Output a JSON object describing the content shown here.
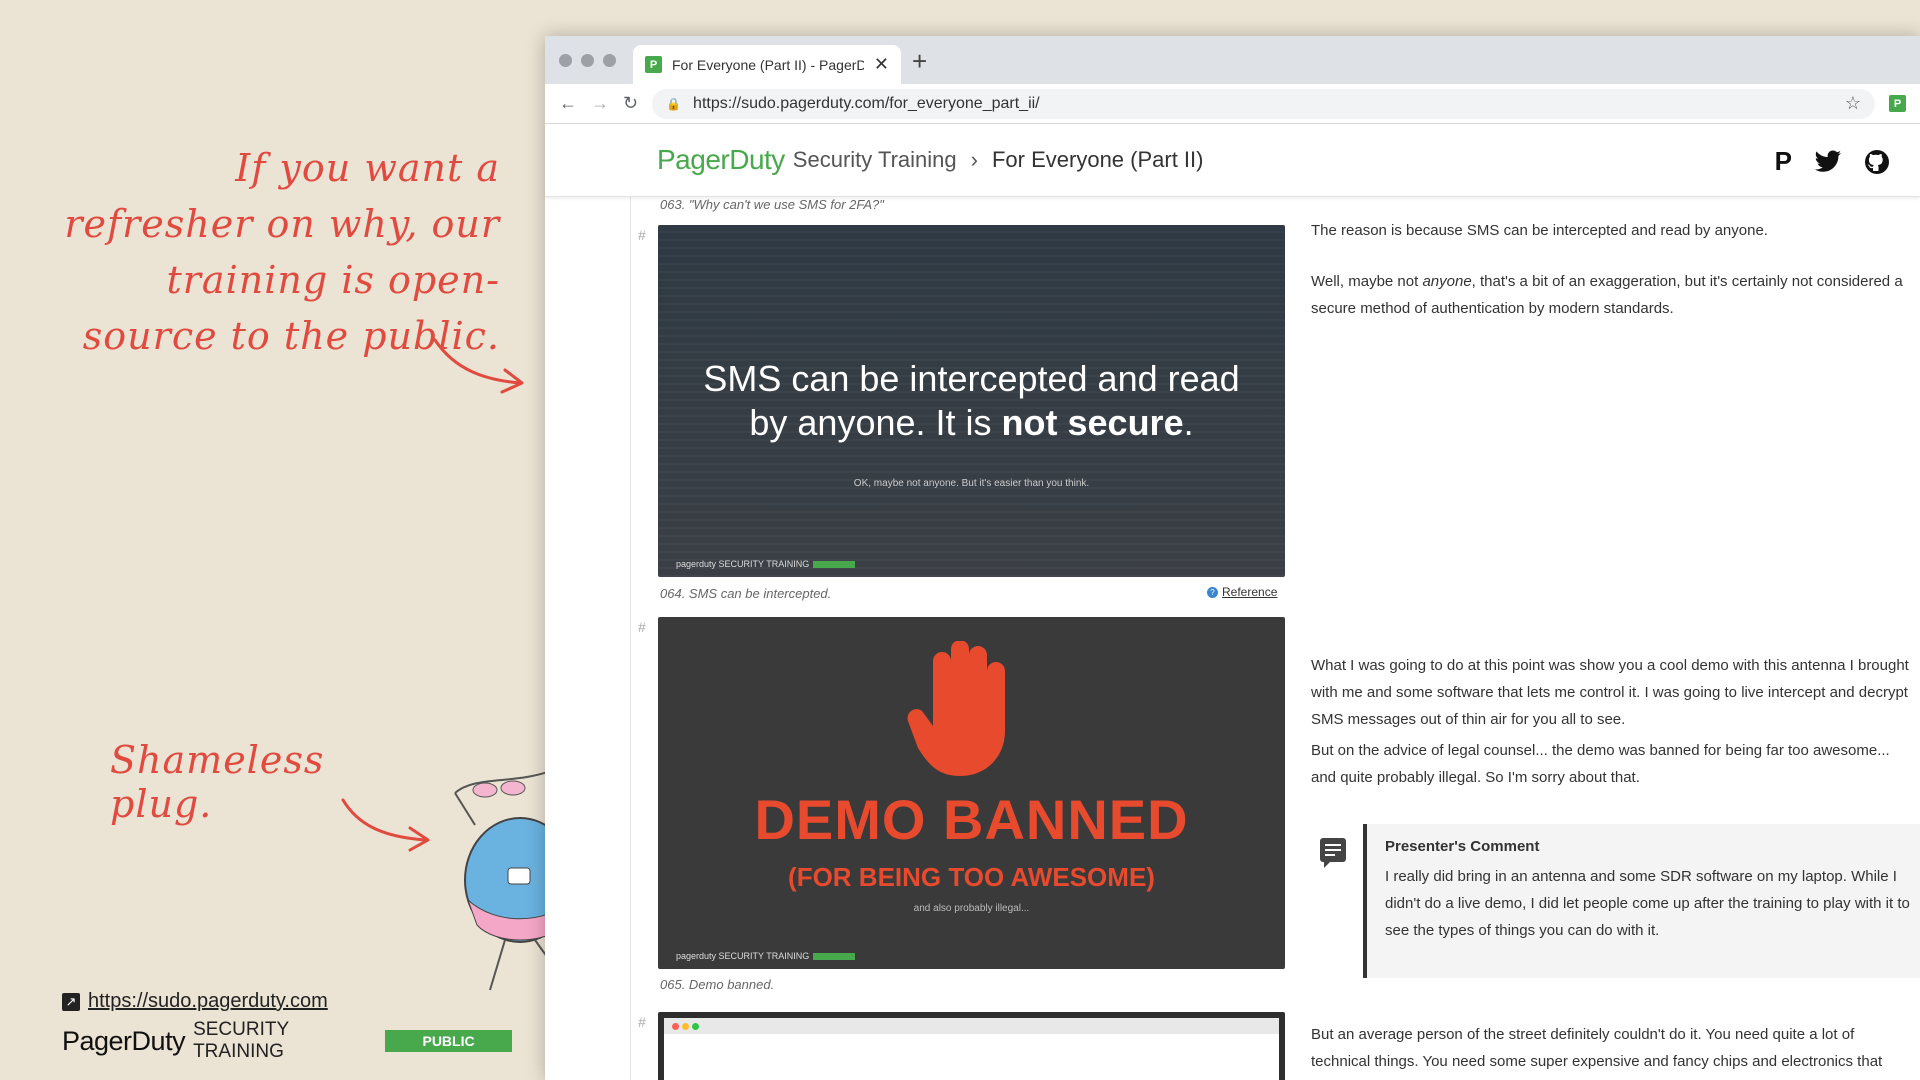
{
  "annotations": {
    "refresher": "If you want a refresher on why, our training is open-source to the public.",
    "plug": "Shameless plug."
  },
  "footer": {
    "url": "https://sudo.pagerduty.com",
    "brand": "PagerDuty",
    "training": "SECURITY TRAINING",
    "badge": "PUBLIC"
  },
  "browser": {
    "tab_title": "For Everyone (Part II) - PagerD",
    "favicon": "P",
    "url": "https://sudo.pagerduty.com/for_everyone_part_ii/"
  },
  "site": {
    "logo": "PagerDuty",
    "section": "Security Training",
    "separator": "›",
    "page": "For Everyone (Part II)",
    "icons": [
      "pagerduty-icon",
      "twitter-icon",
      "github-icon"
    ]
  },
  "content": {
    "caption_063": "063. \"Why can't we use SMS for 2FA?\"",
    "slide1": {
      "line1": "SMS can be intercepted and read",
      "line2_pre": "by anyone. It is ",
      "line2_bold": "not secure",
      "line2_post": ".",
      "small": "OK, maybe not anyone. But it's easier than you think.",
      "brand": "pagerduty SECURITY TRAINING"
    },
    "caption_064": "064. SMS can be intercepted.",
    "reference": "Reference",
    "para1": "The reason is because SMS can be intercepted and read by anyone.",
    "para2_pre": "Well, maybe not ",
    "para2_em": "anyone",
    "para2_post": ", that's a bit of an exaggeration, but it's certainly not considered a secure method of authentication by modern standards.",
    "slide2": {
      "title": "DEMO BANNED",
      "subtitle": "(FOR BEING TOO AWESOME)",
      "small": "and also probably illegal..."
    },
    "caption_065": "065. Demo banned.",
    "para3": "What I was going to do at this point was show you a cool demo with this antenna I brought with me and some software that lets me control it. I was going to live intercept and decrypt SMS messages out of thin air for you all to see.",
    "para4": "But on the advice of legal counsel... the demo was banned for being far too awesome... and quite probably illegal. So I'm sorry about that.",
    "comment_heading": "Presenter's Comment",
    "comment_body": "I really did bring in an antenna and some SDR software on my laptop. While I didn't do a live demo, I did let people come up after the training to play with it to see the types of things you can do with it.",
    "para5": "But an average person of the street definitely couldn't do it. You need quite a lot of technical things. You need some super expensive and fancy chips and electronics that costs thousands and thousands of dollars..."
  },
  "colors": {
    "annotation": "#e04a3f",
    "brand_green": "#48a84c",
    "banned_red": "#e84a2e"
  }
}
